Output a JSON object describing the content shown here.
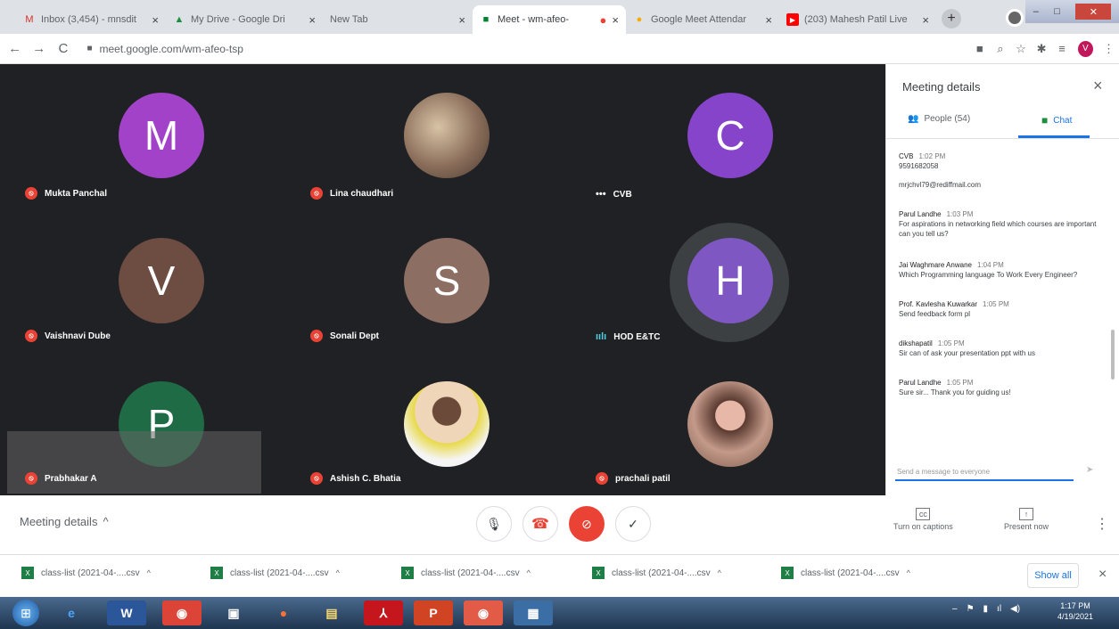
{
  "tabs": [
    {
      "title": "Inbox (3,454) - mnsdit",
      "favicon": "M",
      "color": "#d93025"
    },
    {
      "title": "My Drive - Google Dri",
      "favicon": "▲",
      "color": "#1e8e3e"
    },
    {
      "title": "New Tab",
      "favicon": "",
      "color": "#888"
    },
    {
      "title": "Meet - wm-afeo-",
      "favicon": "■",
      "color": "#00832d"
    },
    {
      "title": "Google Meet Attendar",
      "favicon": "●",
      "color": "#f9ab00"
    },
    {
      "title": "(203) Mahesh Patil Live",
      "favicon": "▶",
      "color": "#ff0000"
    }
  ],
  "browser": {
    "url": "meet.google.com/wm-afeo-tsp",
    "profile_initial": "V"
  },
  "participants": [
    {
      "initial": "M",
      "name": "Mukta Panchal",
      "color": "#a142c9",
      "status": "muted"
    },
    {
      "initial": "",
      "name": "Lina chaudhari",
      "color": "#8a6d5a",
      "status": "muted",
      "photo": true
    },
    {
      "initial": "C",
      "name": "CVB",
      "color": "#8544c9",
      "status": "dots"
    },
    {
      "initial": "V",
      "name": "Vaishnavi Dube",
      "color": "#6d4c41",
      "status": "muted"
    },
    {
      "initial": "S",
      "name": "Sonali Dept",
      "color": "#8d6e63",
      "status": "muted"
    },
    {
      "initial": "H",
      "name": "HOD E&TC",
      "color": "#7e57c2",
      "status": "speaking"
    },
    {
      "initial": "P",
      "name": "Prabhakar A",
      "color": "#1e6b45",
      "status": "muted"
    },
    {
      "initial": "",
      "name": "Ashish C. Bhatia",
      "color": "#f5f5f5",
      "status": "muted",
      "photo": true
    },
    {
      "initial": "",
      "name": "prachali patil",
      "color": "#c49a8a",
      "status": "muted",
      "photo": true
    }
  ],
  "panel": {
    "title": "Meeting details",
    "tab_people": "People (54)",
    "tab_chat": "Chat",
    "input_placeholder": "Send a message to everyone",
    "messages": [
      {
        "sender": "CVB",
        "time": "1:02 PM",
        "text": "9591682058"
      },
      {
        "sender": "",
        "time": "",
        "text": "mrjchvl79@rediffmail.com"
      },
      {
        "sender": "Parul Landhe",
        "time": "1:03 PM",
        "text": "For aspirations in networking field which courses are important can you tell us?"
      },
      {
        "sender": "Jai Waghmare Anwane",
        "time": "1:04 PM",
        "text": "Which Programming language To Work Every Engineer?"
      },
      {
        "sender": "Prof. Kavlesha Kuwarkar",
        "time": "1:05 PM",
        "text": "Send feedback form pl"
      },
      {
        "sender": "dikshapatil",
        "time": "1:05 PM",
        "text": "Sir can of ask your presentation ppt with us"
      },
      {
        "sender": "Parul Landhe",
        "time": "1:05 PM",
        "text": "Sure sir... Thank you for guiding us!"
      }
    ]
  },
  "controls": {
    "meeting_details_label": "Meeting details",
    "captions_label": "Turn on captions",
    "present_label": "Present now"
  },
  "downloads": [
    {
      "name": "class-list (2021-04-....csv"
    },
    {
      "name": "class-list (2021-04-....csv"
    },
    {
      "name": "class-list (2021-04-....csv"
    },
    {
      "name": "class-list (2021-04-....csv"
    },
    {
      "name": "class-list (2021-04-....csv"
    }
  ],
  "downloads_show_all": "Show all",
  "taskbar": {
    "time": "1:17 PM",
    "date": "4/19/2021"
  }
}
